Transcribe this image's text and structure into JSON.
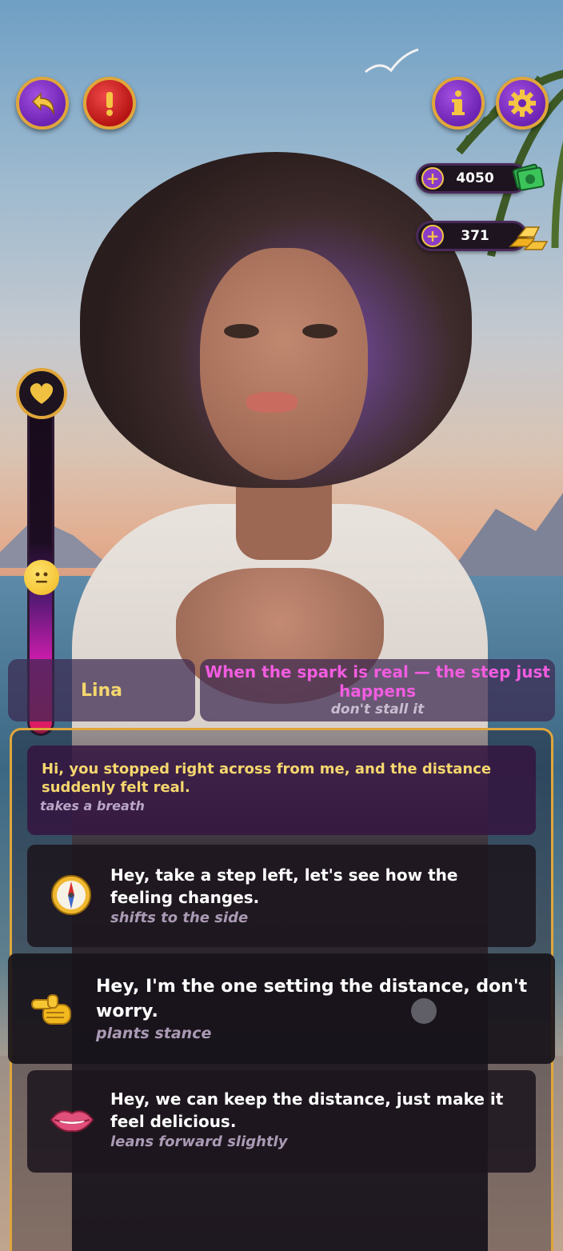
{
  "top_bar": {
    "back_icon": "back-arrow-icon",
    "report_icon": "exclamation-icon",
    "info_icon": "info-icon",
    "settings_icon": "gear-icon"
  },
  "currencies": {
    "cash": {
      "value": "4050",
      "icon": "cash-icon"
    },
    "gold": {
      "value": "371",
      "icon": "gold-bars-icon"
    }
  },
  "love_meter": {
    "top_icon": "heart-icon",
    "mood_icon": "neutral-face-emoji-icon"
  },
  "dialog_header": {
    "character_name": "Lina",
    "hint_title": "When the spark is real — the step just happens",
    "hint_subtitle": "don't stall it"
  },
  "npc_message": {
    "text": "Hi, you stopped right across from me, and the distance suddenly felt real.",
    "action": "takes a breath"
  },
  "options": [
    {
      "icon": "compass-icon",
      "text": "Hey, take a step left, let's see how the feeling changes.",
      "action": "shifts to the side"
    },
    {
      "icon": "pointing-hand-icon",
      "text": "Hey, I'm the one setting the distance, don't worry.",
      "action": "plants stance"
    },
    {
      "icon": "lips-icon",
      "text": "Hey, we can keep the distance, just make it feel delicious.",
      "action": "leans forward slightly"
    }
  ],
  "colors": {
    "gold_border": "#e0a63a",
    "name_text": "#f5d76e",
    "hint_text": "#f25ce0",
    "button_purple": "#6d23b3",
    "button_red": "#b61414"
  }
}
